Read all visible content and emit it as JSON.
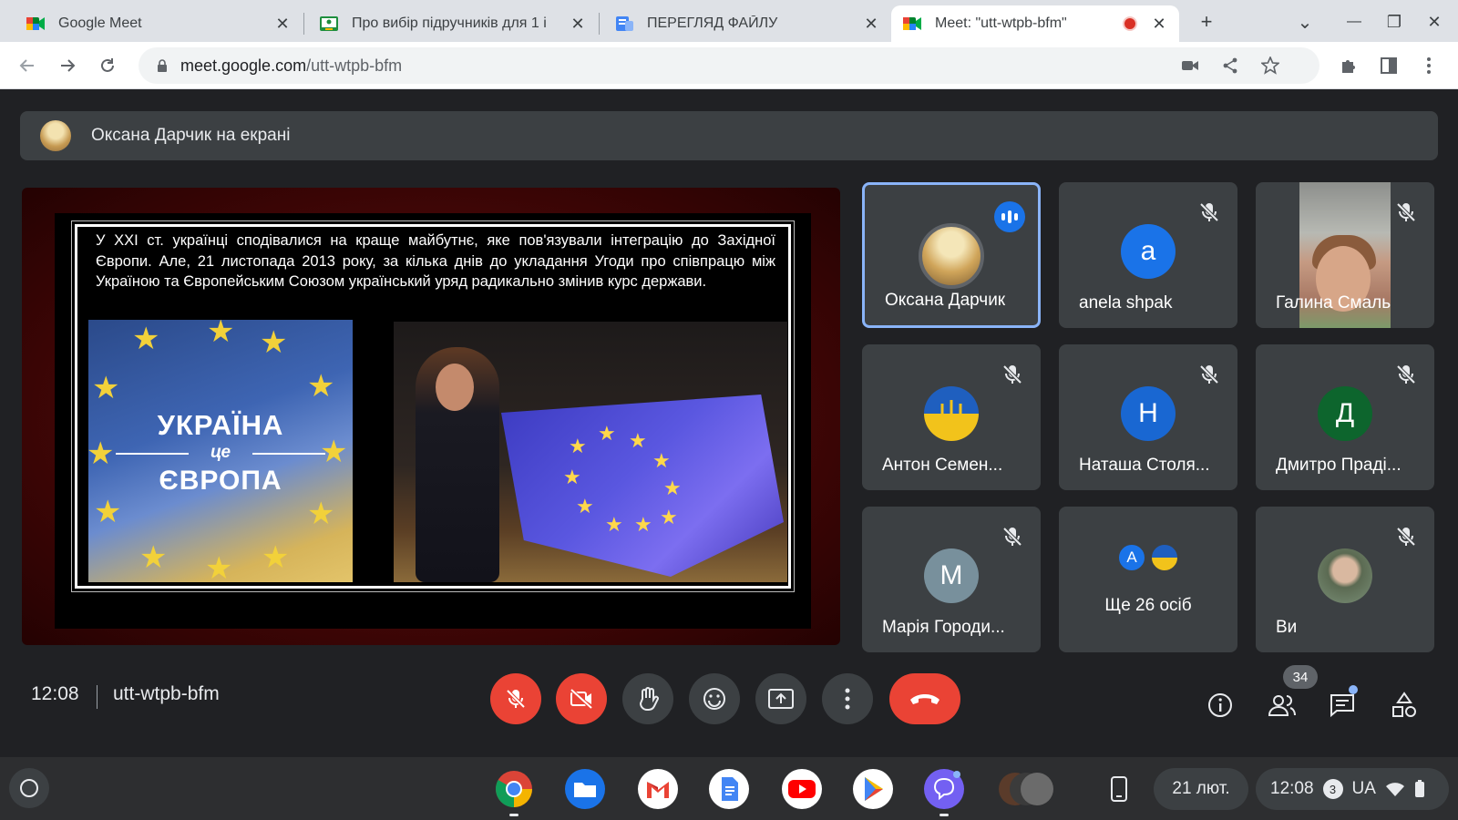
{
  "tabs": [
    {
      "title": "Google Meet",
      "close": "✕"
    },
    {
      "title": "Про вибір підручників для 1 і",
      "close": "✕"
    },
    {
      "title": "ПЕРЕГЛЯД ФАЙЛУ",
      "close": "✕"
    },
    {
      "title": "Meet: \"utt-wtpb-bfm\"",
      "close": "✕",
      "active": true
    }
  ],
  "strip": {
    "new_tab": "+",
    "tab_search": "⌄",
    "minimize": "—",
    "restore": "❐",
    "close": "✕"
  },
  "address": {
    "host": "meet.google.com",
    "path": "/utt-wtpb-bfm"
  },
  "banner": {
    "text": "Оксана Дарчик на екрані"
  },
  "slide": {
    "paragraph": "У XXI ст. українці сподівалися на краще майбутнє, яке пов'язували інтеграцію до Західної Європи. Але, 21 листопада 2013 року, за кілька днів до укладання Угоди про співпрацю між Україною та Європейським Союзом український уряд радикально змінив курс держави.",
    "title_line1": "УКРАЇНА",
    "title_line2": "це",
    "title_line3": "ЄВРОПА"
  },
  "participants": [
    {
      "name": "Оксана Дарчик",
      "type": "photo",
      "speaking": true
    },
    {
      "name": "anela shpak",
      "initial": "a",
      "color": "#1a73e8",
      "muted": true
    },
    {
      "name": "Галина Смаль",
      "type": "video",
      "muted": true
    },
    {
      "name": "Антон Семен...",
      "type": "emblem",
      "muted": true
    },
    {
      "name": "Наташа Столя...",
      "initial": "Н",
      "color": "#1967d2",
      "muted": true
    },
    {
      "name": "Дмитро Праді...",
      "initial": "Д",
      "color": "#0d652d",
      "muted": true
    },
    {
      "name": "Марія Городи...",
      "initial": "М",
      "color": "#78909c",
      "muted": true
    },
    {
      "name": "Ще 26 осіб",
      "type": "more",
      "mini_initial": "A"
    },
    {
      "name": "Ви",
      "type": "photo2",
      "muted": true
    }
  ],
  "controls": {
    "time": "12:08",
    "meeting_code": "utt-wtpb-bfm",
    "people_count": "34"
  },
  "shelf": {
    "date": "21 лют.",
    "time": "12:08",
    "notifications": "3",
    "layout": "UA"
  },
  "colors": {
    "accent": "#8ab4f8",
    "danger": "#ea4335",
    "tile": "#3c4043",
    "bg": "#202124"
  }
}
